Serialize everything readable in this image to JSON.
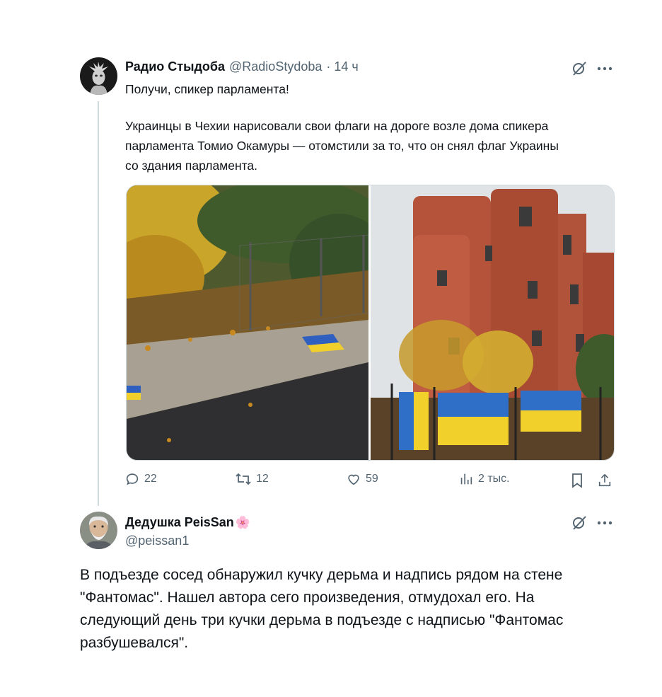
{
  "tweet1": {
    "author_name": "Радио Стыдоба",
    "handle": "@RadioStydoba",
    "time": "· 14 ч",
    "text_line1": "Получи, спикер парламента!",
    "text_para2_l1": "Украинцы в Чехии нарисовали свои флаги на дороге возле дома спикера",
    "text_para2_l2": "парламента Томио Окамуры — отомстили за то, что он снял флаг Украины",
    "text_para2_l3": "со здания парламента.",
    "stats": {
      "replies": "22",
      "reposts": "12",
      "likes": "59",
      "views": "2 тыс."
    }
  },
  "tweet2": {
    "author_name": "Дедушка PeisSan",
    "name_emoji": "🌸",
    "handle": "@peissan1",
    "text_l1": "В подъезде сосед обнаружил кучку дерьма и надпись рядом на стене",
    "text_l2": "\"Фантомас\". Нашел автора сего произведения, отмудохал его. На",
    "text_l3": "следующий день три кучки дерьма в подъезде с надписью \"Фантомас",
    "text_l4": "разбушевался\"."
  },
  "colors": {
    "text": "#0f1419",
    "secondary": "#536471",
    "divider": "#cfd9de",
    "flag_blue": "#1f5fbf",
    "flag_yellow": "#f2d02b"
  },
  "icons": [
    "grok-icon",
    "more-icon",
    "reply-icon",
    "repost-icon",
    "like-icon",
    "views-icon",
    "bookmark-icon",
    "share-icon"
  ]
}
